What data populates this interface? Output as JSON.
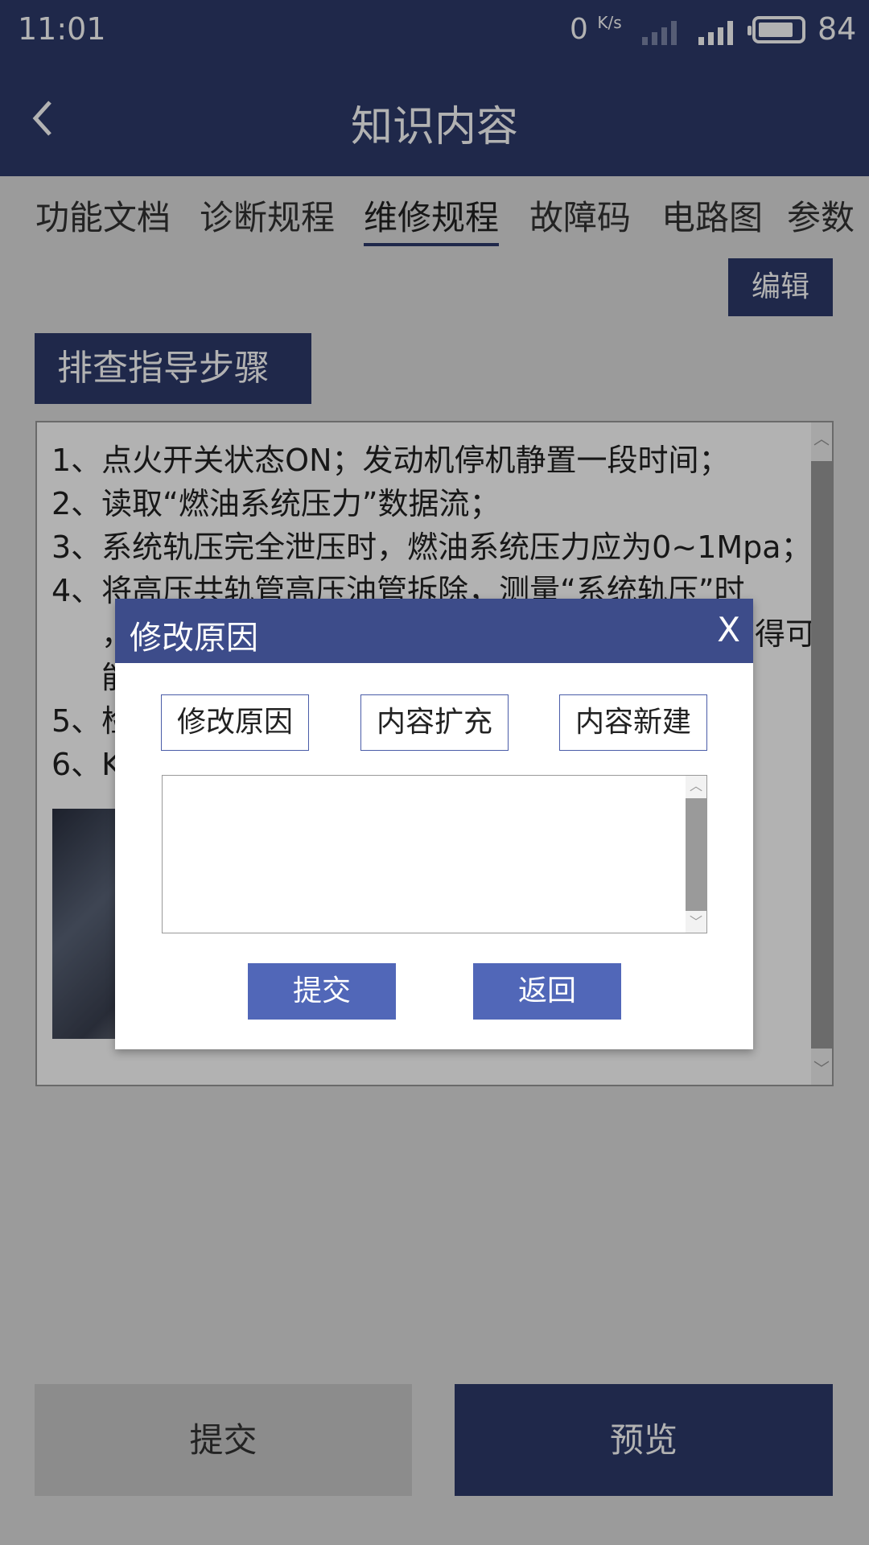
{
  "status": {
    "time": "11:01",
    "net_speed": "0",
    "net_unit": "K/s",
    "battery": "84"
  },
  "header": {
    "title": "知识内容"
  },
  "tabs": [
    {
      "label": "功能文档"
    },
    {
      "label": "诊断规程"
    },
    {
      "label": "维修规程",
      "active": true
    },
    {
      "label": "故障码"
    },
    {
      "label": "电路图"
    },
    {
      "label": "参数"
    }
  ],
  "edit_label": "编辑",
  "section_title": "排查指导步骤",
  "content": {
    "lines": [
      "1、点火开关状态ON；发动机停机静置一段时间；",
      "2、读取“燃油系统压力”数据流；",
      "3、系统轨压完全泄压时，燃油系统压力应为0~1Mpa；",
      "4、将高压共轨管高压油管拆除，测量“系统轨压”时",
      "，",
      "能",
      "5、检",
      "6、K"
    ],
    "partial_text": "得可"
  },
  "dialog": {
    "title": "修改原因",
    "close": "X",
    "options": [
      "修改原因",
      "内容扩充",
      "内容新建"
    ],
    "submit": "提交",
    "back": "返回"
  },
  "footer": {
    "submit": "提交",
    "preview": "预览"
  }
}
